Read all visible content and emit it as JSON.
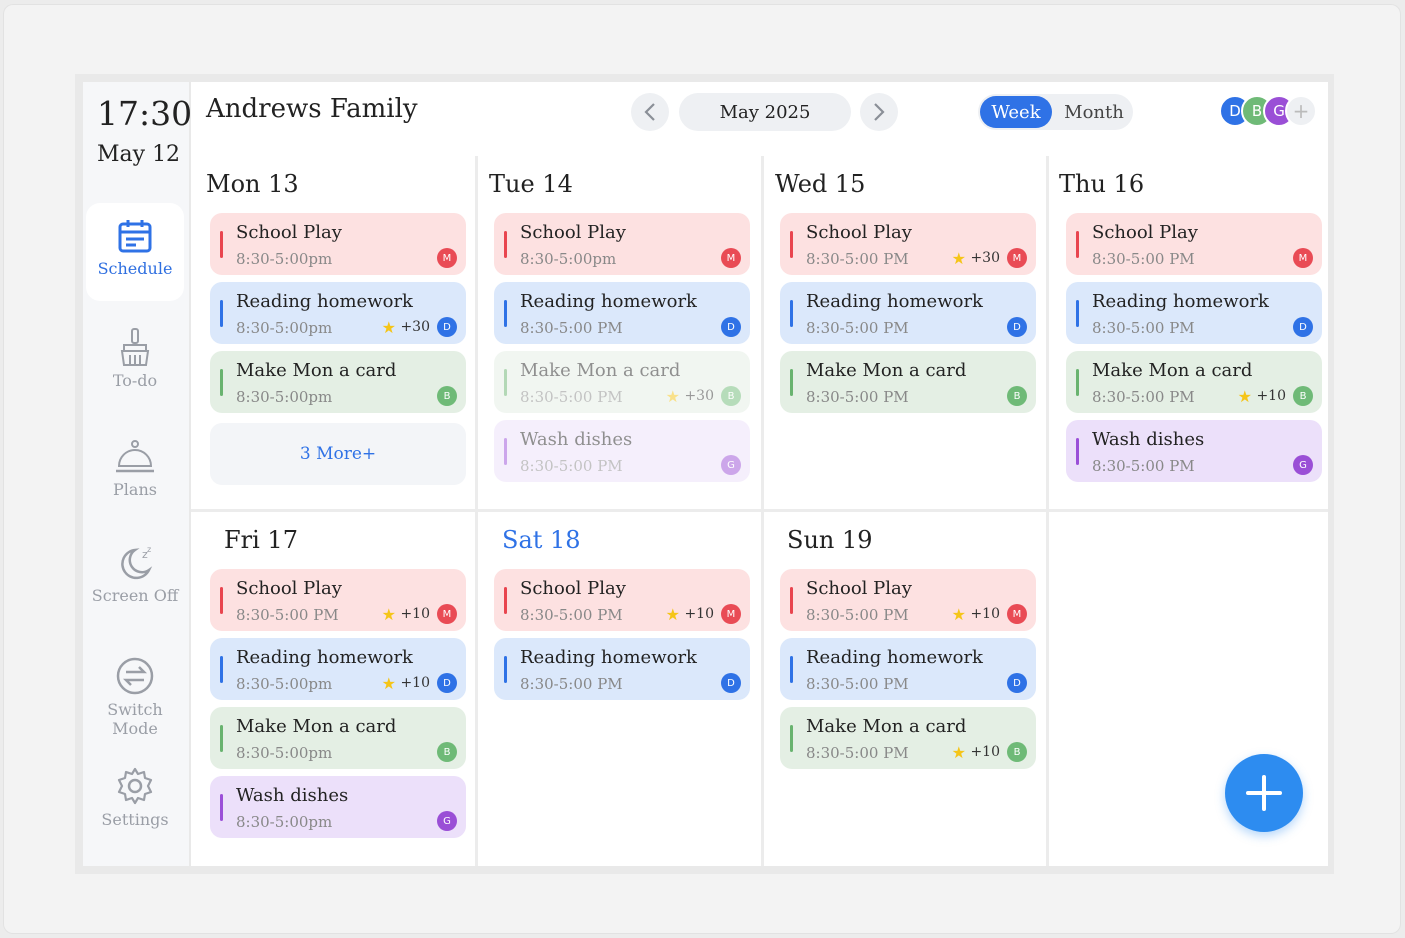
{
  "clock": {
    "time": "17:30",
    "date": "May 12"
  },
  "sidebar": {
    "items": [
      {
        "label": "Schedule",
        "icon": "calendar-icon",
        "active": true
      },
      {
        "label": "To-do",
        "icon": "broom-icon",
        "active": false
      },
      {
        "label": "Plans",
        "icon": "cloche-icon",
        "active": false
      },
      {
        "label": "Screen Off",
        "icon": "moon-icon",
        "active": false
      },
      {
        "label": "Switch Mode",
        "icon": "switch-icon",
        "active": false
      },
      {
        "label": "Settings",
        "icon": "gear-icon",
        "active": false
      }
    ]
  },
  "header": {
    "title": "Andrews Family",
    "month": "May 2025",
    "view_week": "Week",
    "view_month": "Month",
    "avatars": [
      {
        "initial": "D",
        "color": "#2f72e6"
      },
      {
        "initial": "B",
        "color": "#6fba77"
      },
      {
        "initial": "G",
        "color": "#9a4fd6"
      },
      {
        "initial": "+",
        "color": "#eef0f3"
      }
    ]
  },
  "colors": {
    "accent": "#2f72e6",
    "red": "#e94b55",
    "blue": "#2f72e6",
    "green": "#6fba77",
    "purple": "#9a4fd6",
    "star": "#f5c518"
  },
  "days": [
    {
      "title": "Mon 13",
      "more": "3 More+",
      "events": [
        {
          "title": "School Play",
          "time": "8:30-5:00pm",
          "color": "red",
          "member": "M",
          "points": ""
        },
        {
          "title": "Reading homework",
          "time": "8:30-5:00pm",
          "color": "blue",
          "member": "D",
          "points": "+30"
        },
        {
          "title": "Make Mon a card",
          "time": "8:30-5:00pm",
          "color": "green",
          "member": "B",
          "points": ""
        }
      ]
    },
    {
      "title": "Tue 14",
      "events": [
        {
          "title": "School Play",
          "time": "8:30-5:00pm",
          "color": "red",
          "member": "M",
          "points": ""
        },
        {
          "title": "Reading homework",
          "time": "8:30-5:00 PM",
          "color": "blue",
          "member": "D",
          "points": ""
        },
        {
          "title": "Make Mon a card",
          "time": "8:30-5:00 PM",
          "color": "green",
          "member": "B",
          "points": "+30",
          "faded": true
        },
        {
          "title": "Wash dishes",
          "time": "8:30-5:00 PM",
          "color": "purple",
          "member": "G",
          "points": "",
          "faded": true
        }
      ]
    },
    {
      "title": "Wed 15",
      "events": [
        {
          "title": "School Play",
          "time": "8:30-5:00 PM",
          "color": "red",
          "member": "M",
          "points": "+30"
        },
        {
          "title": "Reading homework",
          "time": "8:30-5:00 PM",
          "color": "blue",
          "member": "D",
          "points": ""
        },
        {
          "title": "Make Mon a card",
          "time": "8:30-5:00 PM",
          "color": "green",
          "member": "B",
          "points": ""
        }
      ]
    },
    {
      "title": "Thu 16",
      "events": [
        {
          "title": "School Play",
          "time": "8:30-5:00 PM",
          "color": "red",
          "member": "M",
          "points": ""
        },
        {
          "title": "Reading homework",
          "time": "8:30-5:00 PM",
          "color": "blue",
          "member": "D",
          "points": ""
        },
        {
          "title": "Make Mon a card",
          "time": "8:30-5:00 PM",
          "color": "green",
          "member": "B",
          "points": "+10"
        },
        {
          "title": "Wash dishes",
          "time": "8:30-5:00 PM",
          "color": "purple",
          "member": "G",
          "points": ""
        }
      ]
    },
    {
      "title": "Fri 17",
      "events": [
        {
          "title": "School Play",
          "time": "8:30-5:00 PM",
          "color": "red",
          "member": "M",
          "points": "+10"
        },
        {
          "title": "Reading homework",
          "time": "8:30-5:00pm",
          "color": "blue",
          "member": "D",
          "points": "+10"
        },
        {
          "title": "Make Mon a card",
          "time": "8:30-5:00pm",
          "color": "green",
          "member": "B",
          "points": ""
        },
        {
          "title": "Wash dishes",
          "time": "8:30-5:00pm",
          "color": "purple",
          "member": "G",
          "points": ""
        }
      ]
    },
    {
      "title": "Sat 18",
      "highlight": true,
      "events": [
        {
          "title": "School Play",
          "time": "8:30-5:00 PM",
          "color": "red",
          "member": "M",
          "points": "+10"
        },
        {
          "title": "Reading homework",
          "time": "8:30-5:00 PM",
          "color": "blue",
          "member": "D",
          "points": ""
        }
      ]
    },
    {
      "title": "Sun 19",
      "events": [
        {
          "title": "School Play",
          "time": "8:30-5:00 PM",
          "color": "red",
          "member": "M",
          "points": "+10"
        },
        {
          "title": "Reading homework",
          "time": "8:30-5:00 PM",
          "color": "blue",
          "member": "D",
          "points": ""
        },
        {
          "title": "Make Mon a card",
          "time": "8:30-5:00 PM",
          "color": "green",
          "member": "B",
          "points": "+10"
        }
      ]
    }
  ],
  "fab": {
    "icon": "plus-icon"
  }
}
